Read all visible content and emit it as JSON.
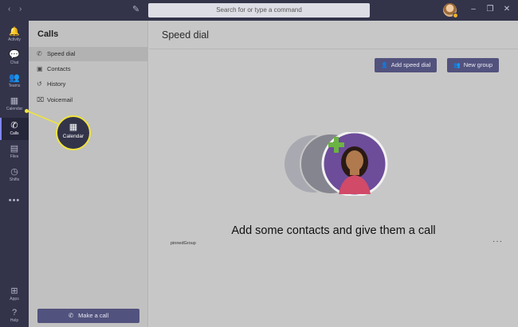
{
  "titlebar": {
    "search_placeholder": "Search for or type a command",
    "back_glyph": "‹",
    "forward_glyph": "›",
    "compose_glyph": "✎",
    "minimize_glyph": "–",
    "maximize_glyph": "❐",
    "close_glyph": "✕"
  },
  "rail": {
    "items": [
      {
        "label": "Activity",
        "icon": "bell-icon",
        "glyph": "🔔"
      },
      {
        "label": "Chat",
        "icon": "chat-icon",
        "glyph": "💬"
      },
      {
        "label": "Teams",
        "icon": "teams-icon",
        "glyph": "👥"
      },
      {
        "label": "Calendar",
        "icon": "calendar-icon",
        "glyph": "▦"
      },
      {
        "label": "Calls",
        "icon": "phone-icon",
        "glyph": "✆"
      },
      {
        "label": "Files",
        "icon": "files-icon",
        "glyph": "▤"
      },
      {
        "label": "Shifts",
        "icon": "clock-icon",
        "glyph": "◷"
      }
    ],
    "more_glyph": "•••",
    "bottom": [
      {
        "label": "Apps",
        "icon": "apps-icon",
        "glyph": "⊞"
      },
      {
        "label": "Help",
        "icon": "help-icon",
        "glyph": "?"
      }
    ]
  },
  "sidebar": {
    "title": "Calls",
    "items": [
      {
        "label": "Speed dial",
        "icon": "phone-icon",
        "glyph": "✆"
      },
      {
        "label": "Contacts",
        "icon": "contacts-icon",
        "glyph": "▣"
      },
      {
        "label": "History",
        "icon": "history-icon",
        "glyph": "↺"
      },
      {
        "label": "Voicemail",
        "icon": "voicemail-icon",
        "glyph": "⌧"
      }
    ],
    "make_call_label": "Make a call",
    "make_call_glyph": "✆"
  },
  "main": {
    "title": "Speed dial",
    "add_speed_dial_label": "Add speed dial",
    "new_group_label": "New group",
    "add_glyph": "⁺",
    "empty_message": "Add some contacts and give them a call",
    "pinned_group_label": "pinnedGroup",
    "more_glyph": "···"
  },
  "callout": {
    "label": "Calendar",
    "glyph": "▦"
  },
  "colors": {
    "rail_bg": "#33344a",
    "accent": "#52527e",
    "highlight": "#f0e43c",
    "add_green": "#6bb443",
    "illustration_purple": "#6d4c9a"
  }
}
